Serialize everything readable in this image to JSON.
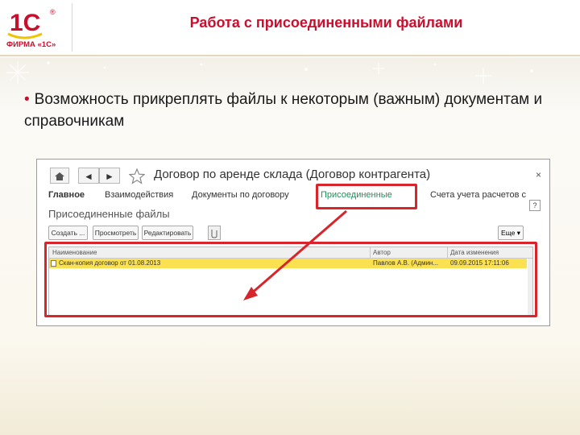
{
  "brand": {
    "logo_mark": "1С",
    "logo_caption": "ФИРМА «1С»",
    "registered": "®",
    "accent": "#c8102e"
  },
  "slide": {
    "title": "Работа с присоединенными файлами",
    "bullet": "Возможность прикреплять файлы к некоторым (важным) документам и справочникам"
  },
  "window": {
    "title": "Договор по аренде склада (Договор контрагента)",
    "nav": {
      "home_icon": "home-icon",
      "back": "◄",
      "forward": "►",
      "star_icon": "star-icon"
    },
    "close": "×",
    "help": "?",
    "tabs": [
      {
        "label": "Главное"
      },
      {
        "label": "Взаимодействия"
      },
      {
        "label": "Документы по договору"
      },
      {
        "label": "Присоединенные"
      },
      {
        "label": "Счета учета расчетов с"
      }
    ],
    "section_title": "Присоединенные файлы",
    "toolbar": {
      "create": "Создать ...",
      "view": "Просмотреть",
      "edit": "Редактировать",
      "more": "Еще ▾"
    },
    "table": {
      "columns": [
        "Наименование",
        "Автор",
        "Дата изменения"
      ],
      "rows": [
        {
          "name": "Скан-копия договор от 01.08.2013",
          "author": "Павлов А.В. (Админ...",
          "date": "09.09.2015 17:11:06"
        }
      ]
    }
  },
  "annotation": {
    "highlight_color": "#d7252b"
  }
}
